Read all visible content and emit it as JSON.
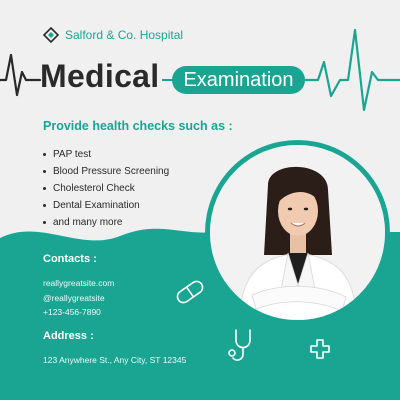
{
  "brand": {
    "name": "Salford & Co. Hospital",
    "color": "#1aa593"
  },
  "title": {
    "main": "Medical",
    "pill": "Examination"
  },
  "checks": {
    "heading": "Provide health checks such as :",
    "items": [
      "PAP test",
      "Blood Pressure Screening",
      "Cholesterol Check",
      "Dental Examination",
      "and many more"
    ]
  },
  "contacts": {
    "heading": "Contacts :",
    "website": "reallygreatsite.com",
    "handle": "@reallygreatsite",
    "phone": "+123-456-7890"
  },
  "address": {
    "heading": "Address :",
    "line": "123 Anywhere St., Any City, ST 12345"
  },
  "icons": [
    "pill-icon",
    "stethoscope-icon",
    "plus-cross-icon",
    "hospital-logo-icon"
  ]
}
